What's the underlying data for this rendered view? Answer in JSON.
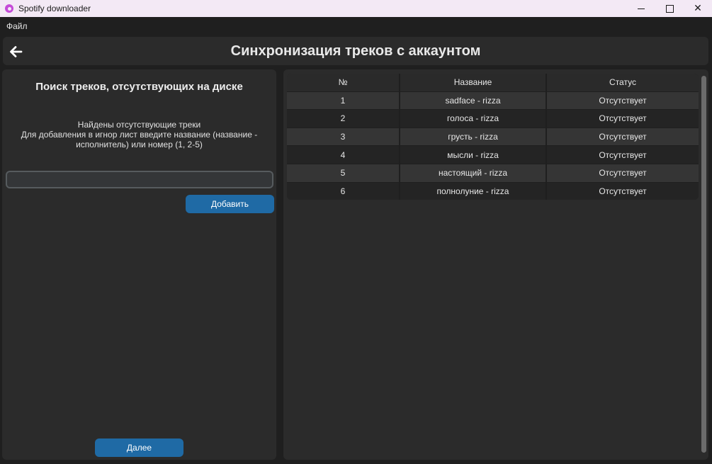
{
  "window": {
    "title": "Spotify downloader",
    "controls": {
      "minimize_icon": "minimize-icon",
      "maximize_icon": "maximize-icon",
      "close_label": "✕"
    }
  },
  "menubar": {
    "file_label": "Файл"
  },
  "header": {
    "title": "Синхронизация треков с аккаунтом",
    "back_icon": "arrow-left-icon"
  },
  "left": {
    "title": "Поиск треков, отсутствующих на диске",
    "info_line1": "Найдены отсутствующие треки",
    "info_line2": "Для добавления в игнор лист введите название (название -",
    "info_line3": "исполнитель) или номер (1, 2-5)",
    "input_value": "",
    "add_button": "Добавить",
    "next_button": "Далее"
  },
  "table": {
    "columns": [
      "№",
      "Название",
      "Статус"
    ],
    "rows": [
      [
        "1",
        "sadface - rizza",
        "Отсутствует"
      ],
      [
        "2",
        "голоса - rizza",
        "Отсутствует"
      ],
      [
        "3",
        "грусть - rizza",
        "Отсутствует"
      ],
      [
        "4",
        "мысли - rizza",
        "Отсутствует"
      ],
      [
        "5",
        "настоящий - rizza",
        "Отсутствует"
      ],
      [
        "6",
        "полнолуние - rizza",
        "Отсутствует"
      ]
    ]
  },
  "colors": {
    "accent": "#1f6aa5",
    "background": "#1f1f1f",
    "panel": "#2b2b2b",
    "titlebar": "#f3e9f5"
  }
}
